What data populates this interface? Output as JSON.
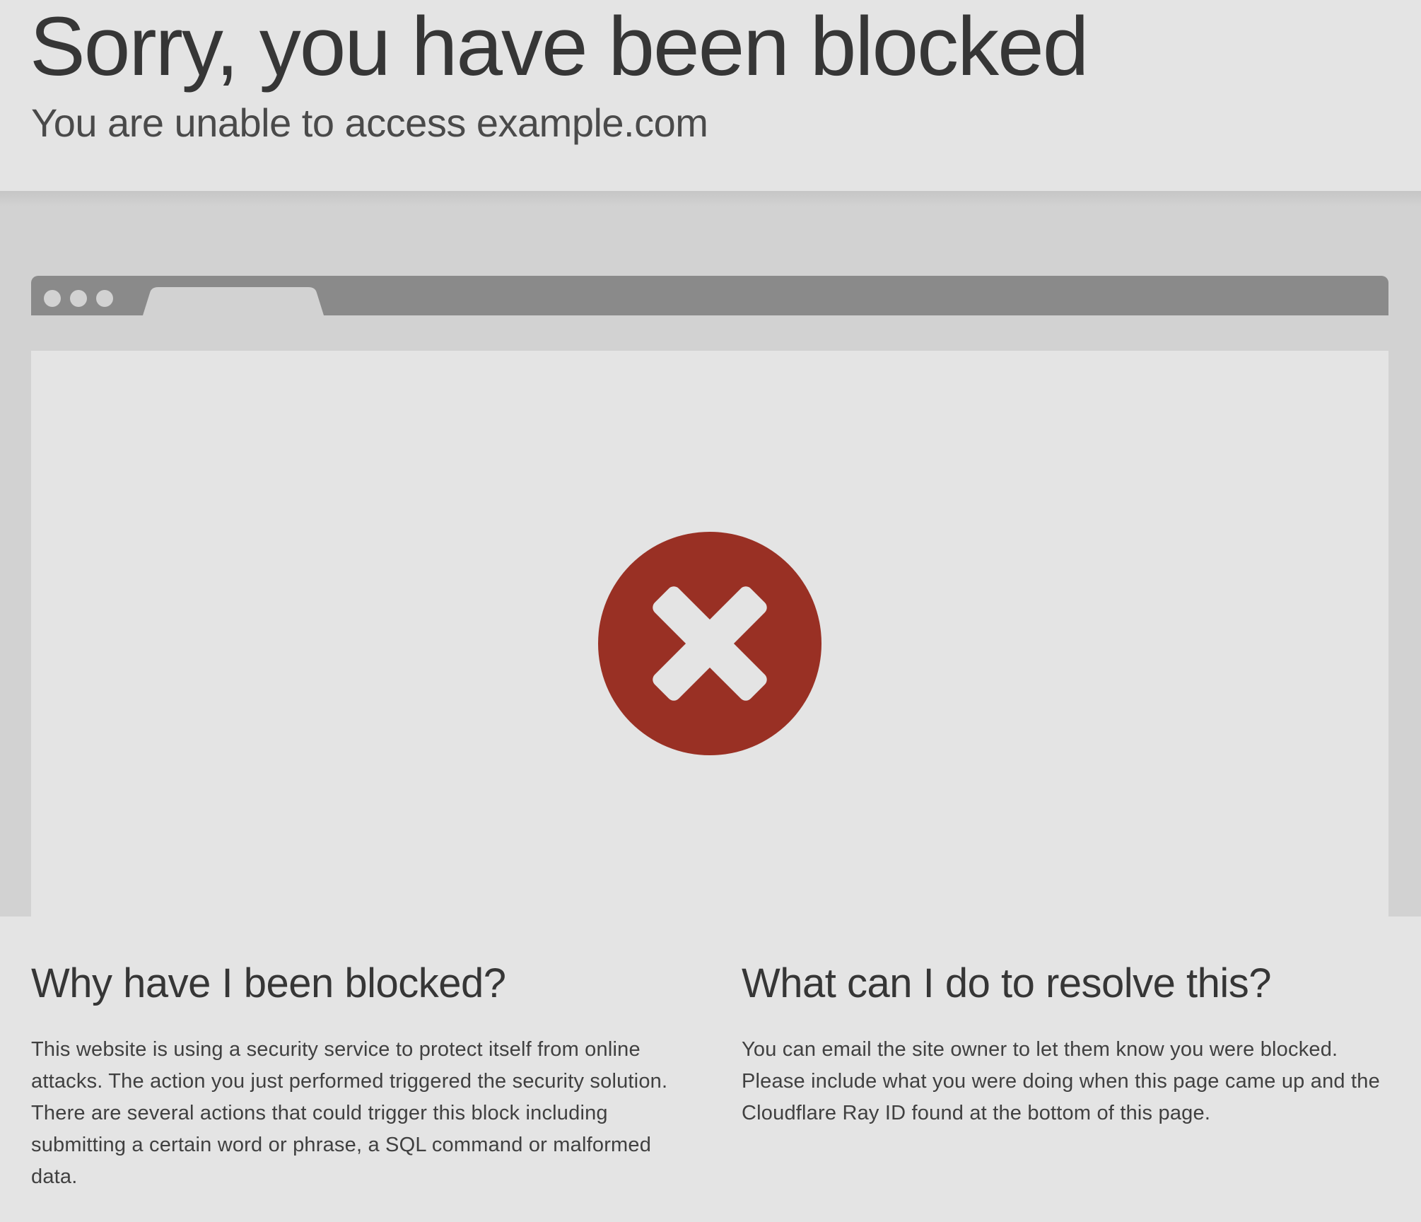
{
  "header": {
    "title": "Sorry, you have been blocked",
    "subtitle": "You are unable to access example.com"
  },
  "illustration": {
    "window_dots": 3,
    "status_icon": "error-x-circle-icon",
    "status_color": "#993024",
    "bar_color": "#8a8a8a",
    "tab_color": "#d2d2d2"
  },
  "why": {
    "heading": "Why have I been blocked?",
    "body": "This website is using a security service to protect itself from online attacks. The action you just performed triggered the security solution. There are several actions that could trigger this block including submitting a certain word or phrase, a SQL command or malformed data."
  },
  "resolve": {
    "heading": "What can I do to resolve this?",
    "body": "You can email the site owner to let them know you were blocked. Please include what you were doing when this page came up and the Cloudflare Ray ID found at the bottom of this page."
  }
}
